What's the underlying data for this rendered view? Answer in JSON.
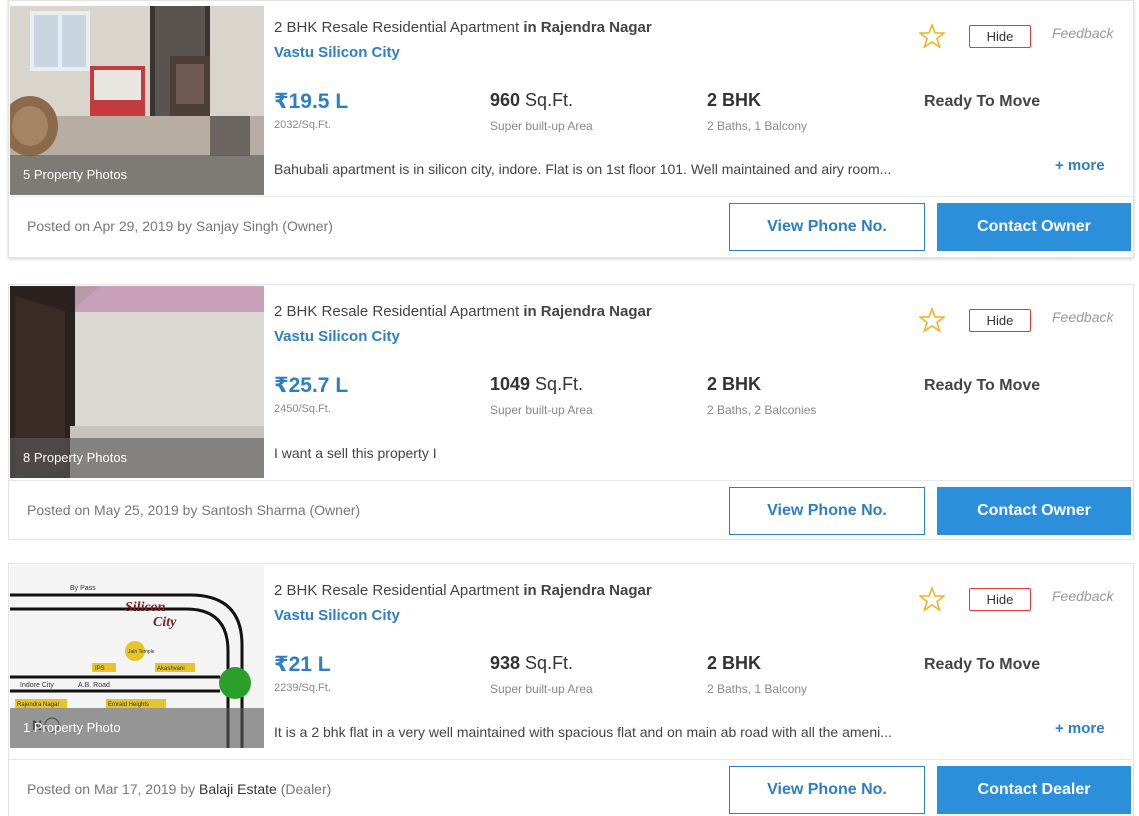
{
  "listings": [
    {
      "photo_count": "5 Property Photos",
      "title_prefix": "2 BHK Resale Residential Apartment",
      "title_location": "in Rajendra Nagar",
      "project": "Vastu Silicon City",
      "hide_label": "Hide",
      "feedback_label": "Feedback",
      "price": "₹19.5 L",
      "price_per_sqft": "2032/Sq.Ft.",
      "area_value": "960",
      "area_unit": " Sq.Ft.",
      "area_type": "Super built-up Area",
      "bhk": "2 BHK",
      "baths_balcony": "2 Baths, 1 Balcony",
      "status": "Ready To Move",
      "description": "Bahubali apartment is in silicon city, indore. Flat is on 1st floor 101. Well maintained and airy room...",
      "more_label": "+ more",
      "posted_prefix": "Posted on Apr 29, 2019 by Sanjay Singh (Owner)",
      "phone_button": "View Phone No.",
      "contact_button": "Contact Owner"
    },
    {
      "photo_count": "8 Property Photos",
      "title_prefix": "2 BHK Resale Residential Apartment",
      "title_location": "in Rajendra Nagar",
      "project": "Vastu Silicon City",
      "hide_label": "Hide",
      "feedback_label": "Feedback",
      "price": "₹25.7 L",
      "price_per_sqft": "2450/Sq.Ft.",
      "area_value": "1049",
      "area_unit": " Sq.Ft.",
      "area_type": "Super built-up Area",
      "bhk": "2 BHK",
      "baths_balcony": "2 Baths, 2 Balconies",
      "status": "Ready To Move",
      "description": "I want a sell this property I",
      "posted_prefix": "Posted on May 25, 2019 by Santosh Sharma (Owner)",
      "phone_button": "View Phone No.",
      "contact_button": "Contact Owner"
    },
    {
      "photo_count": "1 Property Photo",
      "title_prefix": "2 BHK Resale Residential Apartment",
      "title_location": "in Rajendra Nagar",
      "project": "Vastu Silicon City",
      "hide_label": "Hide",
      "feedback_label": "Feedback",
      "price": "₹21 L",
      "price_per_sqft": "2239/Sq.Ft.",
      "area_value": "938",
      "area_unit": " Sq.Ft.",
      "area_type": "Super built-up Area",
      "bhk": "2 BHK",
      "baths_balcony": "2 Baths, 1 Balcony",
      "status": "Ready To Move",
      "description": "It is a 2 bhk flat in a very well maintained with spacious flat and on main ab road with all the ameni...",
      "more_label": "+ more",
      "posted_prefix": "Posted on Mar 17, 2019 by ",
      "posted_dealer": "Balaji Estate",
      "posted_suffix": " (Dealer)",
      "phone_button": "View Phone No.",
      "contact_button": "Contact Dealer",
      "map_labels": {
        "bypass": "By Pass",
        "silicon": "Silicon",
        "city": "City",
        "indore_city": "Indore City",
        "ab_road": "A.B. Road",
        "rajendra": "Rajendra Nagar",
        "emrald": "Emrald Heights",
        "akashvani": "Akashvani",
        "ips": "IPS",
        "jain": "Jain Temple",
        "north": "N"
      }
    }
  ],
  "colors": {
    "accent": "#2d7ec3",
    "button": "#2c8fdc",
    "hide_border": "#e03a3a",
    "star": "#f0b323"
  }
}
